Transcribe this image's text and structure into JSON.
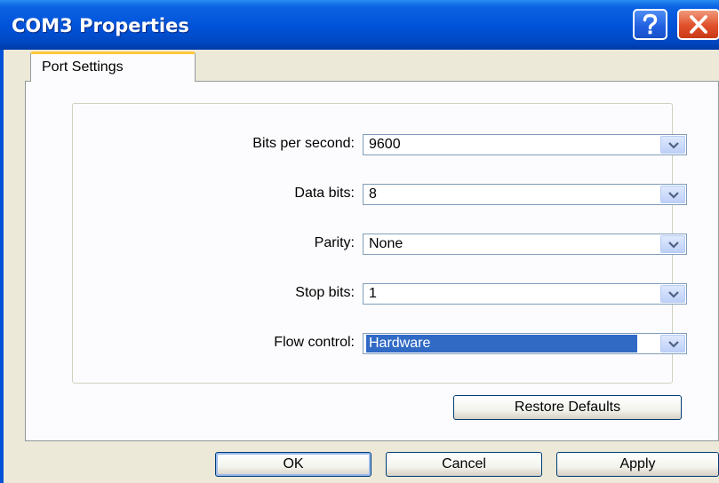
{
  "window": {
    "title": "COM3 Properties",
    "help_icon": "question-mark-icon",
    "close_icon": "close-x-icon",
    "colors": {
      "titlebar": "#0052d8",
      "close": "#e0502a",
      "selection": "#316ac5"
    }
  },
  "tabs": [
    {
      "label": "Port Settings",
      "active": true
    }
  ],
  "fields": {
    "bits_per_second": {
      "label": "Bits per second:",
      "value": "9600"
    },
    "data_bits": {
      "label": "Data bits:",
      "value": "8"
    },
    "parity": {
      "label": "Parity:",
      "value": "None"
    },
    "stop_bits": {
      "label": "Stop bits:",
      "value": "1"
    },
    "flow_control": {
      "label": "Flow control:",
      "value": "Hardware"
    }
  },
  "buttons": {
    "restore_defaults": "Restore Defaults",
    "ok": "OK",
    "cancel": "Cancel",
    "apply": "Apply"
  }
}
